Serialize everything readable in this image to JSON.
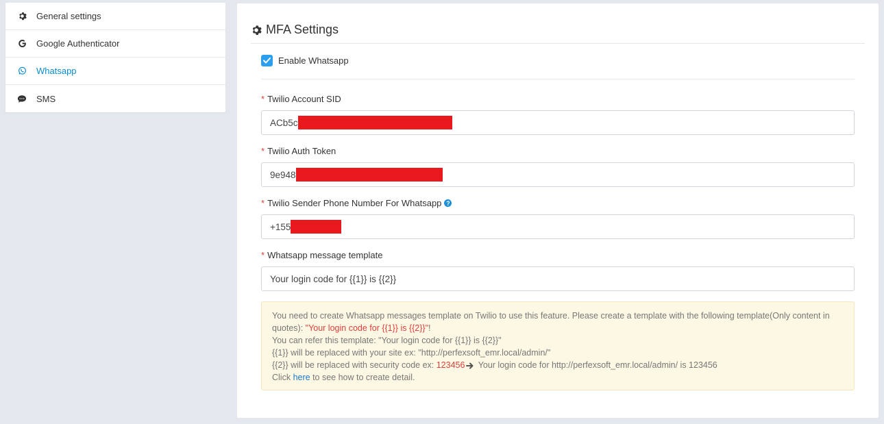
{
  "sidebar": {
    "items": [
      {
        "label": "General settings",
        "icon": "gear-icon"
      },
      {
        "label": "Google Authenticator",
        "icon": "google-icon"
      },
      {
        "label": "Whatsapp",
        "icon": "whatsapp-icon",
        "active": true
      },
      {
        "label": "SMS",
        "icon": "sms-chat-icon"
      }
    ]
  },
  "panel": {
    "title": "MFA Settings",
    "enable_label": "Enable Whatsapp",
    "enable_checked": true,
    "fields": {
      "account_sid": {
        "label": "Twilio Account SID",
        "value_visible": "ACb5c"
      },
      "auth_token": {
        "label": "Twilio Auth Token",
        "value_visible": "9e948"
      },
      "sender_phone": {
        "label": "Twilio Sender Phone Number For Whatsapp",
        "value_visible": "+155"
      },
      "template": {
        "label": "Whatsapp message template",
        "value": "Your login code for {{1}} is {{2}}"
      }
    },
    "required_mark": "*",
    "help_mark": "?",
    "notice": {
      "line1_a": "You need to create Whatsapp messages template on Twilio to use this feature. Please create a template with the following template(Only content in quotes): ",
      "line1_red": "\"Your login code for {{1}} is {{2}}\"",
      "line1_b": "!",
      "line2": "You can refer this template: \"Your login code for {{1}} is {{2}}\"",
      "line3": "{{1}} will be replaced with your site ex: \"http://perfexsoft_emr.local/admin/\"",
      "line4_a": "{{2}} will be replaced with security code ex: ",
      "line4_red": "123456",
      "line4_b": " Your login code for http://perfexsoft_emr.local/admin/ is 123456",
      "line5_a": "Click ",
      "line5_link": "here",
      "line5_b": " to see how to create detail."
    }
  },
  "colors": {
    "accent": "#0a8ccc",
    "checkbox": "#2a9ff0",
    "required": "#e03e3e",
    "redaction": "#e8181c",
    "notice_bg": "#fcf8e3"
  }
}
